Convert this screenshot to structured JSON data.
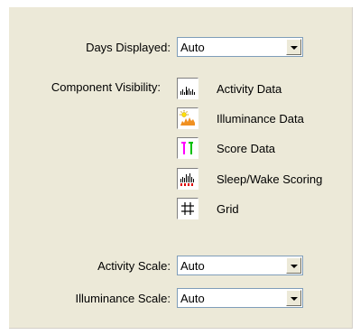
{
  "days_displayed": {
    "label": "Days Displayed:",
    "value": "Auto"
  },
  "component_visibility": {
    "label": "Component Visibility:",
    "items": [
      {
        "label": "Activity Data",
        "icon": "activity-bars-icon"
      },
      {
        "label": "Illuminance Data",
        "icon": "illuminance-sun-icon"
      },
      {
        "label": "Score Data",
        "icon": "score-markers-icon"
      },
      {
        "label": "Sleep/Wake Scoring",
        "icon": "sleep-wake-icon"
      },
      {
        "label": "Grid",
        "icon": "grid-hash-icon"
      }
    ]
  },
  "activity_scale": {
    "label": "Activity Scale:",
    "value": "Auto"
  },
  "illuminance_scale": {
    "label": "Illuminance Scale:",
    "value": "Auto"
  },
  "colors": {
    "panel": "#ece9d8",
    "combo_border": "#7f9db9",
    "illuminance_orange": "#f09020",
    "score_magenta": "#ff00ff",
    "score_green": "#00c000",
    "sleep_red": "#e00000"
  }
}
